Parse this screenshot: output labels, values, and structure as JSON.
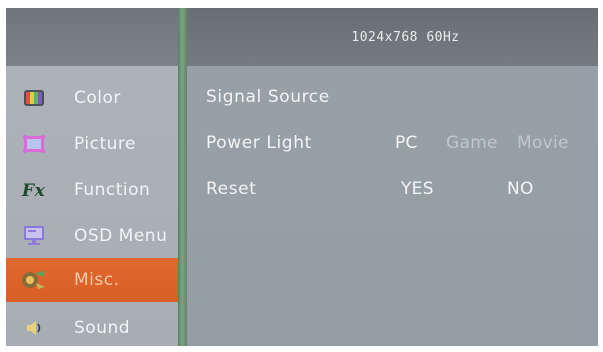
{
  "header": {
    "resolution": "1024x768 60Hz"
  },
  "sidebar": {
    "items": [
      {
        "label": "Color",
        "icon": "color-bars-icon"
      },
      {
        "label": "Picture",
        "icon": "picture-frame-icon"
      },
      {
        "label": "Function",
        "icon": "function-fx-icon"
      },
      {
        "label": "OSD Menu",
        "icon": "osd-monitor-icon"
      },
      {
        "label": "Misc.",
        "icon": "misc-tools-icon",
        "selected": true
      },
      {
        "label": "Sound",
        "icon": "speaker-icon"
      }
    ]
  },
  "main": {
    "signal_source": {
      "label": "Signal Source"
    },
    "power_light": {
      "label": "Power Light",
      "options": [
        "PC",
        "Game",
        "Movie"
      ],
      "selected": "PC"
    },
    "reset": {
      "label": "Reset",
      "options": [
        "YES",
        "NO"
      ]
    }
  },
  "colors": {
    "active_item": "#e1692f",
    "divider": "#7ba585",
    "header": "#6e7377",
    "panel": "#98a1a8"
  }
}
